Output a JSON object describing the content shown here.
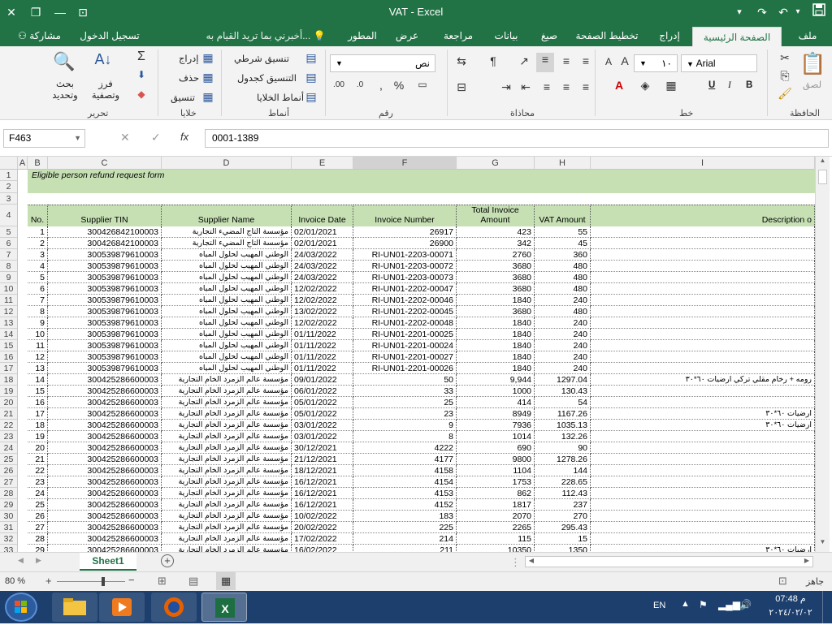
{
  "window": {
    "title": "VAT - Excel"
  },
  "tabs": {
    "file": "ملف",
    "home": "الصفحة الرئيسية",
    "insert": "إدراج",
    "page_layout": "تخطيط الصفحة",
    "formulas": "صيغ",
    "data": "بيانات",
    "review": "مراجعة",
    "view": "عرض",
    "developer": "المطور",
    "tell_me": "أخبرني بما تريد القيام به...",
    "signin": "تسجيل الدخول",
    "share": "مشاركة"
  },
  "ribbon": {
    "paste": "لصق",
    "clipboard_group": "الحافظة",
    "font_name": "Arial",
    "font_size": "١٠",
    "font_group": "خط",
    "alignment_group": "محاذاة",
    "number_format": "نص",
    "number_group": "رقم",
    "conditional_format": "تنسيق شرطي",
    "format_as_table": "التنسيق كجدول",
    "cell_styles": "أنماط الخلايا",
    "styles_group": "أنماط",
    "insert_btn": "إدراج",
    "delete_btn": "حذف",
    "format_btn": "تنسيق",
    "cells_group": "خلايا",
    "sort_filter": "فرز وتصفية",
    "find_select": "بحث وتحديد",
    "editing_group": "تحرير",
    "bold": "B",
    "italic": "I",
    "underline": "U"
  },
  "formula_bar": {
    "name_box": "F463",
    "fx": "fx",
    "value": "0001-1389"
  },
  "columns": [
    "A",
    "B",
    "C",
    "D",
    "E",
    "F",
    "G",
    "H",
    "I"
  ],
  "sheet": {
    "title": "Eligible person refund request form",
    "headers": {
      "no": "No.",
      "tin": "Supplier TIN",
      "name": "Supplier Name",
      "date": "Invoice Date",
      "inv": "Invoice Number",
      "total": "Total Invoice Amount",
      "vat": "VAT Amount",
      "desc": "Description o"
    },
    "rows": [
      {
        "r": "5",
        "no": "1",
        "tin": "300426842100003",
        "name": "مؤسسة التاج المضيء التجارية",
        "date": "02/01/2021",
        "inv": "26917",
        "total": "423",
        "vat": "55",
        "desc": ""
      },
      {
        "r": "6",
        "no": "2",
        "tin": "300426842100003",
        "name": "مؤسسة التاج المضيء التجارية",
        "date": "02/01/2021",
        "inv": "26900",
        "total": "342",
        "vat": "45",
        "desc": ""
      },
      {
        "r": "7",
        "no": "3",
        "tin": "300539879610003",
        "name": "الوطني المهيب لحلول المياه",
        "date": "24/03/2022",
        "inv": "RI-UN01-2203-00071",
        "total": "2760",
        "vat": "360",
        "desc": ""
      },
      {
        "r": "8",
        "no": "4",
        "tin": "300539879610003",
        "name": "الوطني المهيب لحلول المياه",
        "date": "24/03/2022",
        "inv": "RI-UN01-2203-00072",
        "total": "3680",
        "vat": "480",
        "desc": ""
      },
      {
        "r": "9",
        "no": "5",
        "tin": "300539879610003",
        "name": "الوطني المهيب لحلول المياه",
        "date": "24/03/2022",
        "inv": "RI-UN01-2203-00073",
        "total": "3680",
        "vat": "480",
        "desc": ""
      },
      {
        "r": "10",
        "no": "6",
        "tin": "300539879610003",
        "name": "الوطني المهيب لحلول المياه",
        "date": "12/02/2022",
        "inv": "RI-UN01-2202-00047",
        "total": "3680",
        "vat": "480",
        "desc": ""
      },
      {
        "r": "11",
        "no": "7",
        "tin": "300539879610003",
        "name": "الوطني المهيب لحلول المياه",
        "date": "12/02/2022",
        "inv": "RI-UN01-2202-00046",
        "total": "1840",
        "vat": "240",
        "desc": ""
      },
      {
        "r": "12",
        "no": "8",
        "tin": "300539879610003",
        "name": "الوطني المهيب لحلول المياه",
        "date": "13/02/2022",
        "inv": "RI-UN01-2202-00045",
        "total": "3680",
        "vat": "480",
        "desc": ""
      },
      {
        "r": "13",
        "no": "9",
        "tin": "300539879610003",
        "name": "الوطني المهيب لحلول المياه",
        "date": "12/02/2022",
        "inv": "RI-UN01-2202-00048",
        "total": "1840",
        "vat": "240",
        "desc": ""
      },
      {
        "r": "14",
        "no": "10",
        "tin": "300539879610003",
        "name": "الوطني المهيب لحلول المياه",
        "date": "01/11/2022",
        "inv": "RI-UN01-2201-00025",
        "total": "1840",
        "vat": "240",
        "desc": ""
      },
      {
        "r": "15",
        "no": "11",
        "tin": "300539879610003",
        "name": "الوطني المهيب لحلول المياه",
        "date": "01/11/2022",
        "inv": "RI-UN01-2201-00024",
        "total": "1840",
        "vat": "240",
        "desc": ""
      },
      {
        "r": "16",
        "no": "12",
        "tin": "300539879610003",
        "name": "الوطني المهيب لحلول المياه",
        "date": "01/11/2022",
        "inv": "RI-UN01-2201-00027",
        "total": "1840",
        "vat": "240",
        "desc": ""
      },
      {
        "r": "17",
        "no": "13",
        "tin": "300539879610003",
        "name": "الوطني المهيب لحلول المياه",
        "date": "01/11/2022",
        "inv": "RI-UN01-2201-00026",
        "total": "1840",
        "vat": "240",
        "desc": ""
      },
      {
        "r": "18",
        "no": "14",
        "tin": "300425286600003",
        "name": "مؤسسة عالم الزمرد الخام التجارية",
        "date": "09/01/2022",
        "inv": "50",
        "total": "9,944",
        "vat": "1297.04",
        "desc": "رومه + رخام مقلي تركي ارضيات ٦٠*٣٠"
      },
      {
        "r": "19",
        "no": "15",
        "tin": "300425286600003",
        "name": "مؤسسة عالم الزمرد الخام التجارية",
        "date": "06/01/2022",
        "inv": "33",
        "total": "1000",
        "vat": "130.43",
        "desc": ""
      },
      {
        "r": "20",
        "no": "16",
        "tin": "300425286600003",
        "name": "مؤسسة عالم الزمرد الخام التجارية",
        "date": "05/01/2022",
        "inv": "25",
        "total": "414",
        "vat": "54",
        "desc": ""
      },
      {
        "r": "21",
        "no": "17",
        "tin": "300425286600003",
        "name": "مؤسسة عالم الزمرد الخام التجارية",
        "date": "05/01/2022",
        "inv": "23",
        "total": "8949",
        "vat": "1167.26",
        "desc": "ارضيات ٦٠*٣٠"
      },
      {
        "r": "22",
        "no": "18",
        "tin": "300425286600003",
        "name": "مؤسسة عالم الزمرد الخام التجارية",
        "date": "03/01/2022",
        "inv": "9",
        "total": "7936",
        "vat": "1035.13",
        "desc": "ارضيات ٦٠*٣٠"
      },
      {
        "r": "23",
        "no": "19",
        "tin": "300425286600003",
        "name": "مؤسسة عالم الزمرد الخام التجارية",
        "date": "03/01/2022",
        "inv": "8",
        "total": "1014",
        "vat": "132.26",
        "desc": ""
      },
      {
        "r": "24",
        "no": "20",
        "tin": "300425286600003",
        "name": "مؤسسة عالم الزمرد الخام التجارية",
        "date": "30/12/2021",
        "inv": "4222",
        "total": "690",
        "vat": "90",
        "desc": ""
      },
      {
        "r": "25",
        "no": "21",
        "tin": "300425286600003",
        "name": "مؤسسة عالم الزمرد الخام التجارية",
        "date": "21/12/2021",
        "inv": "4177",
        "total": "9800",
        "vat": "1278.26",
        "desc": ""
      },
      {
        "r": "26",
        "no": "22",
        "tin": "300425286600003",
        "name": "مؤسسة عالم الزمرد الخام التجارية",
        "date": "18/12/2021",
        "inv": "4158",
        "total": "1104",
        "vat": "144",
        "desc": ""
      },
      {
        "r": "27",
        "no": "23",
        "tin": "300425286600003",
        "name": "مؤسسة عالم الزمرد الخام التجارية",
        "date": "16/12/2021",
        "inv": "4154",
        "total": "1753",
        "vat": "228.65",
        "desc": ""
      },
      {
        "r": "28",
        "no": "24",
        "tin": "300425286600003",
        "name": "مؤسسة عالم الزمرد الخام التجارية",
        "date": "16/12/2021",
        "inv": "4153",
        "total": "862",
        "vat": "112.43",
        "desc": ""
      },
      {
        "r": "29",
        "no": "25",
        "tin": "300425286600003",
        "name": "مؤسسة عالم الزمرد الخام التجارية",
        "date": "16/12/2021",
        "inv": "4152",
        "total": "1817",
        "vat": "237",
        "desc": ""
      },
      {
        "r": "30",
        "no": "26",
        "tin": "300425286600003",
        "name": "مؤسسة عالم الزمرد الخام التجارية",
        "date": "10/02/2022",
        "inv": "183",
        "total": "2070",
        "vat": "270",
        "desc": ""
      },
      {
        "r": "31",
        "no": "27",
        "tin": "300425286600003",
        "name": "مؤسسة عالم الزمرد الخام التجارية",
        "date": "20/02/2022",
        "inv": "225",
        "total": "2265",
        "vat": "295.43",
        "desc": ""
      },
      {
        "r": "32",
        "no": "28",
        "tin": "300425286600003",
        "name": "مؤسسة عالم الزمرد الخام التجارية",
        "date": "17/02/2022",
        "inv": "214",
        "total": "115",
        "vat": "15",
        "desc": ""
      },
      {
        "r": "33",
        "no": "29",
        "tin": "300425286600003",
        "name": "مؤسسة عالم الزمرد الخام التجارية",
        "date": "16/02/2022",
        "inv": "211",
        "total": "10350",
        "vat": "1350",
        "desc": "ارضيات ٦٠*٣٠"
      }
    ]
  },
  "sheet_tab": "Sheet1",
  "status": {
    "ready": "جاهز",
    "zoom": "80 %"
  },
  "taskbar": {
    "lang": "EN",
    "time": "07:48 م",
    "date": "٢٠٢٤/٠٢/٠٢"
  }
}
